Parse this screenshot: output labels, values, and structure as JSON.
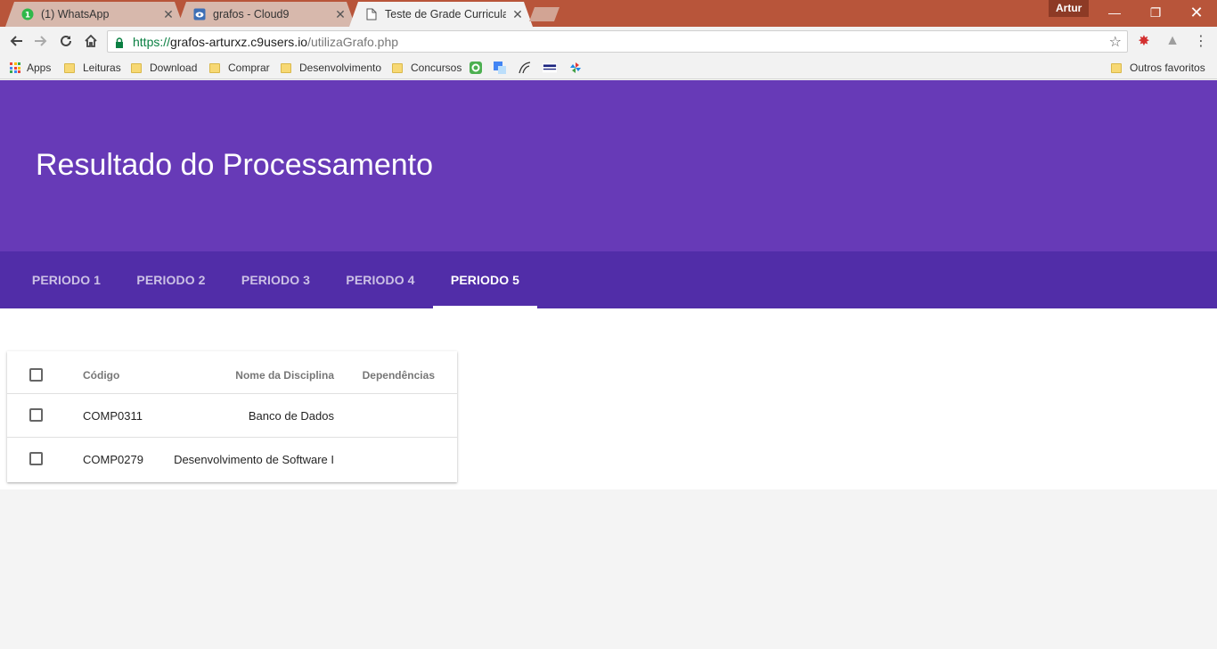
{
  "browser": {
    "tabs": [
      {
        "label": "(1) WhatsApp",
        "favicon": "whatsapp-icon",
        "badge": "1"
      },
      {
        "label": "grafos - Cloud9",
        "favicon": "cloud9-icon"
      },
      {
        "label": "Teste de Grade Curricular",
        "favicon": "document-icon",
        "active": true
      }
    ],
    "profile": "Artur",
    "url": {
      "scheme": "https://",
      "host": "grafos-arturxz.c9users.io",
      "path": "/utilizaGrafo.php"
    },
    "bookmarks": [
      {
        "label": "Apps",
        "icon": "apps-grid-icon"
      },
      {
        "label": "Leituras",
        "icon": "folder-icon"
      },
      {
        "label": "Download",
        "icon": "folder-icon"
      },
      {
        "label": "Comprar",
        "icon": "folder-icon"
      },
      {
        "label": "Desenvolvimento",
        "icon": "folder-icon"
      },
      {
        "label": "Concursos",
        "icon": "folder-icon"
      }
    ],
    "other_bookmarks": "Outros favoritos"
  },
  "page": {
    "title": "Resultado do Processamento",
    "tabs": [
      "PERIODO 1",
      "PERIODO 2",
      "PERIODO 3",
      "PERIODO 4",
      "PERIODO 5"
    ],
    "active_tab": "PERIODO 5",
    "table": {
      "columns": [
        "Código",
        "Nome da Disciplina",
        "Dependências"
      ],
      "rows": [
        {
          "code": "COMP0311",
          "name": "Banco de Dados",
          "deps": ""
        },
        {
          "code": "COMP0279",
          "name": "Desenvolvimento de Software I",
          "deps": ""
        }
      ]
    }
  },
  "colors": {
    "primary": "#673ab7",
    "primary_dark": "#512da8",
    "titlebar": "#b8553a"
  }
}
